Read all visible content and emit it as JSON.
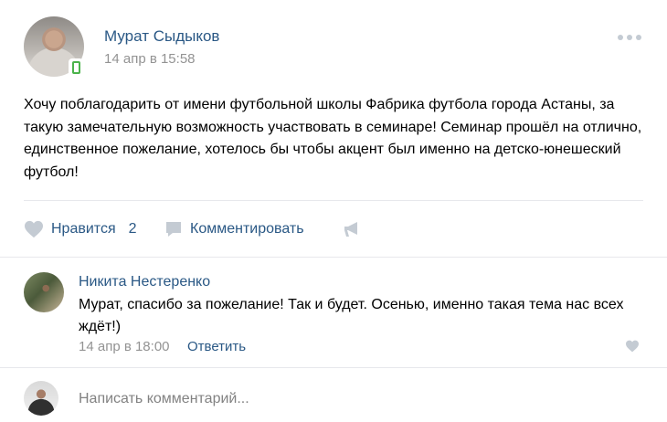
{
  "post": {
    "author": "Мурат Сыдыков",
    "date": "14 апр в 15:58",
    "text": "Хочу поблагодарить от имени футбольной школы Фабрика футбола города Астаны, за такую замечательную возможность участвовать в семинаре! Семинар прошёл на отлично, единственное пожелание, хотелось бы чтобы акцент был именно на детско-юнешеский футбол!"
  },
  "actions": {
    "like_label": "Нравится",
    "like_count": "2",
    "comment_label": "Комментировать"
  },
  "comment": {
    "author": "Никита Нестеренко",
    "text": "Мурат, спасибо за пожелание! Так и будет. Осенью, именно такая тема нас всех ждёт!)",
    "date": "14 апр в 18:00",
    "reply_label": "Ответить"
  },
  "composer": {
    "placeholder": "Написать комментарий..."
  },
  "icons": {
    "mobile": "mobile-phone-icon",
    "more": "more-dots-icon",
    "like": "heart-icon",
    "comment": "comment-bubble-icon",
    "share": "megaphone-icon"
  },
  "colors": {
    "link": "#2a5885",
    "muted": "#939393",
    "icon": "#c4cbd3",
    "online_mobile": "#4bb34b"
  }
}
